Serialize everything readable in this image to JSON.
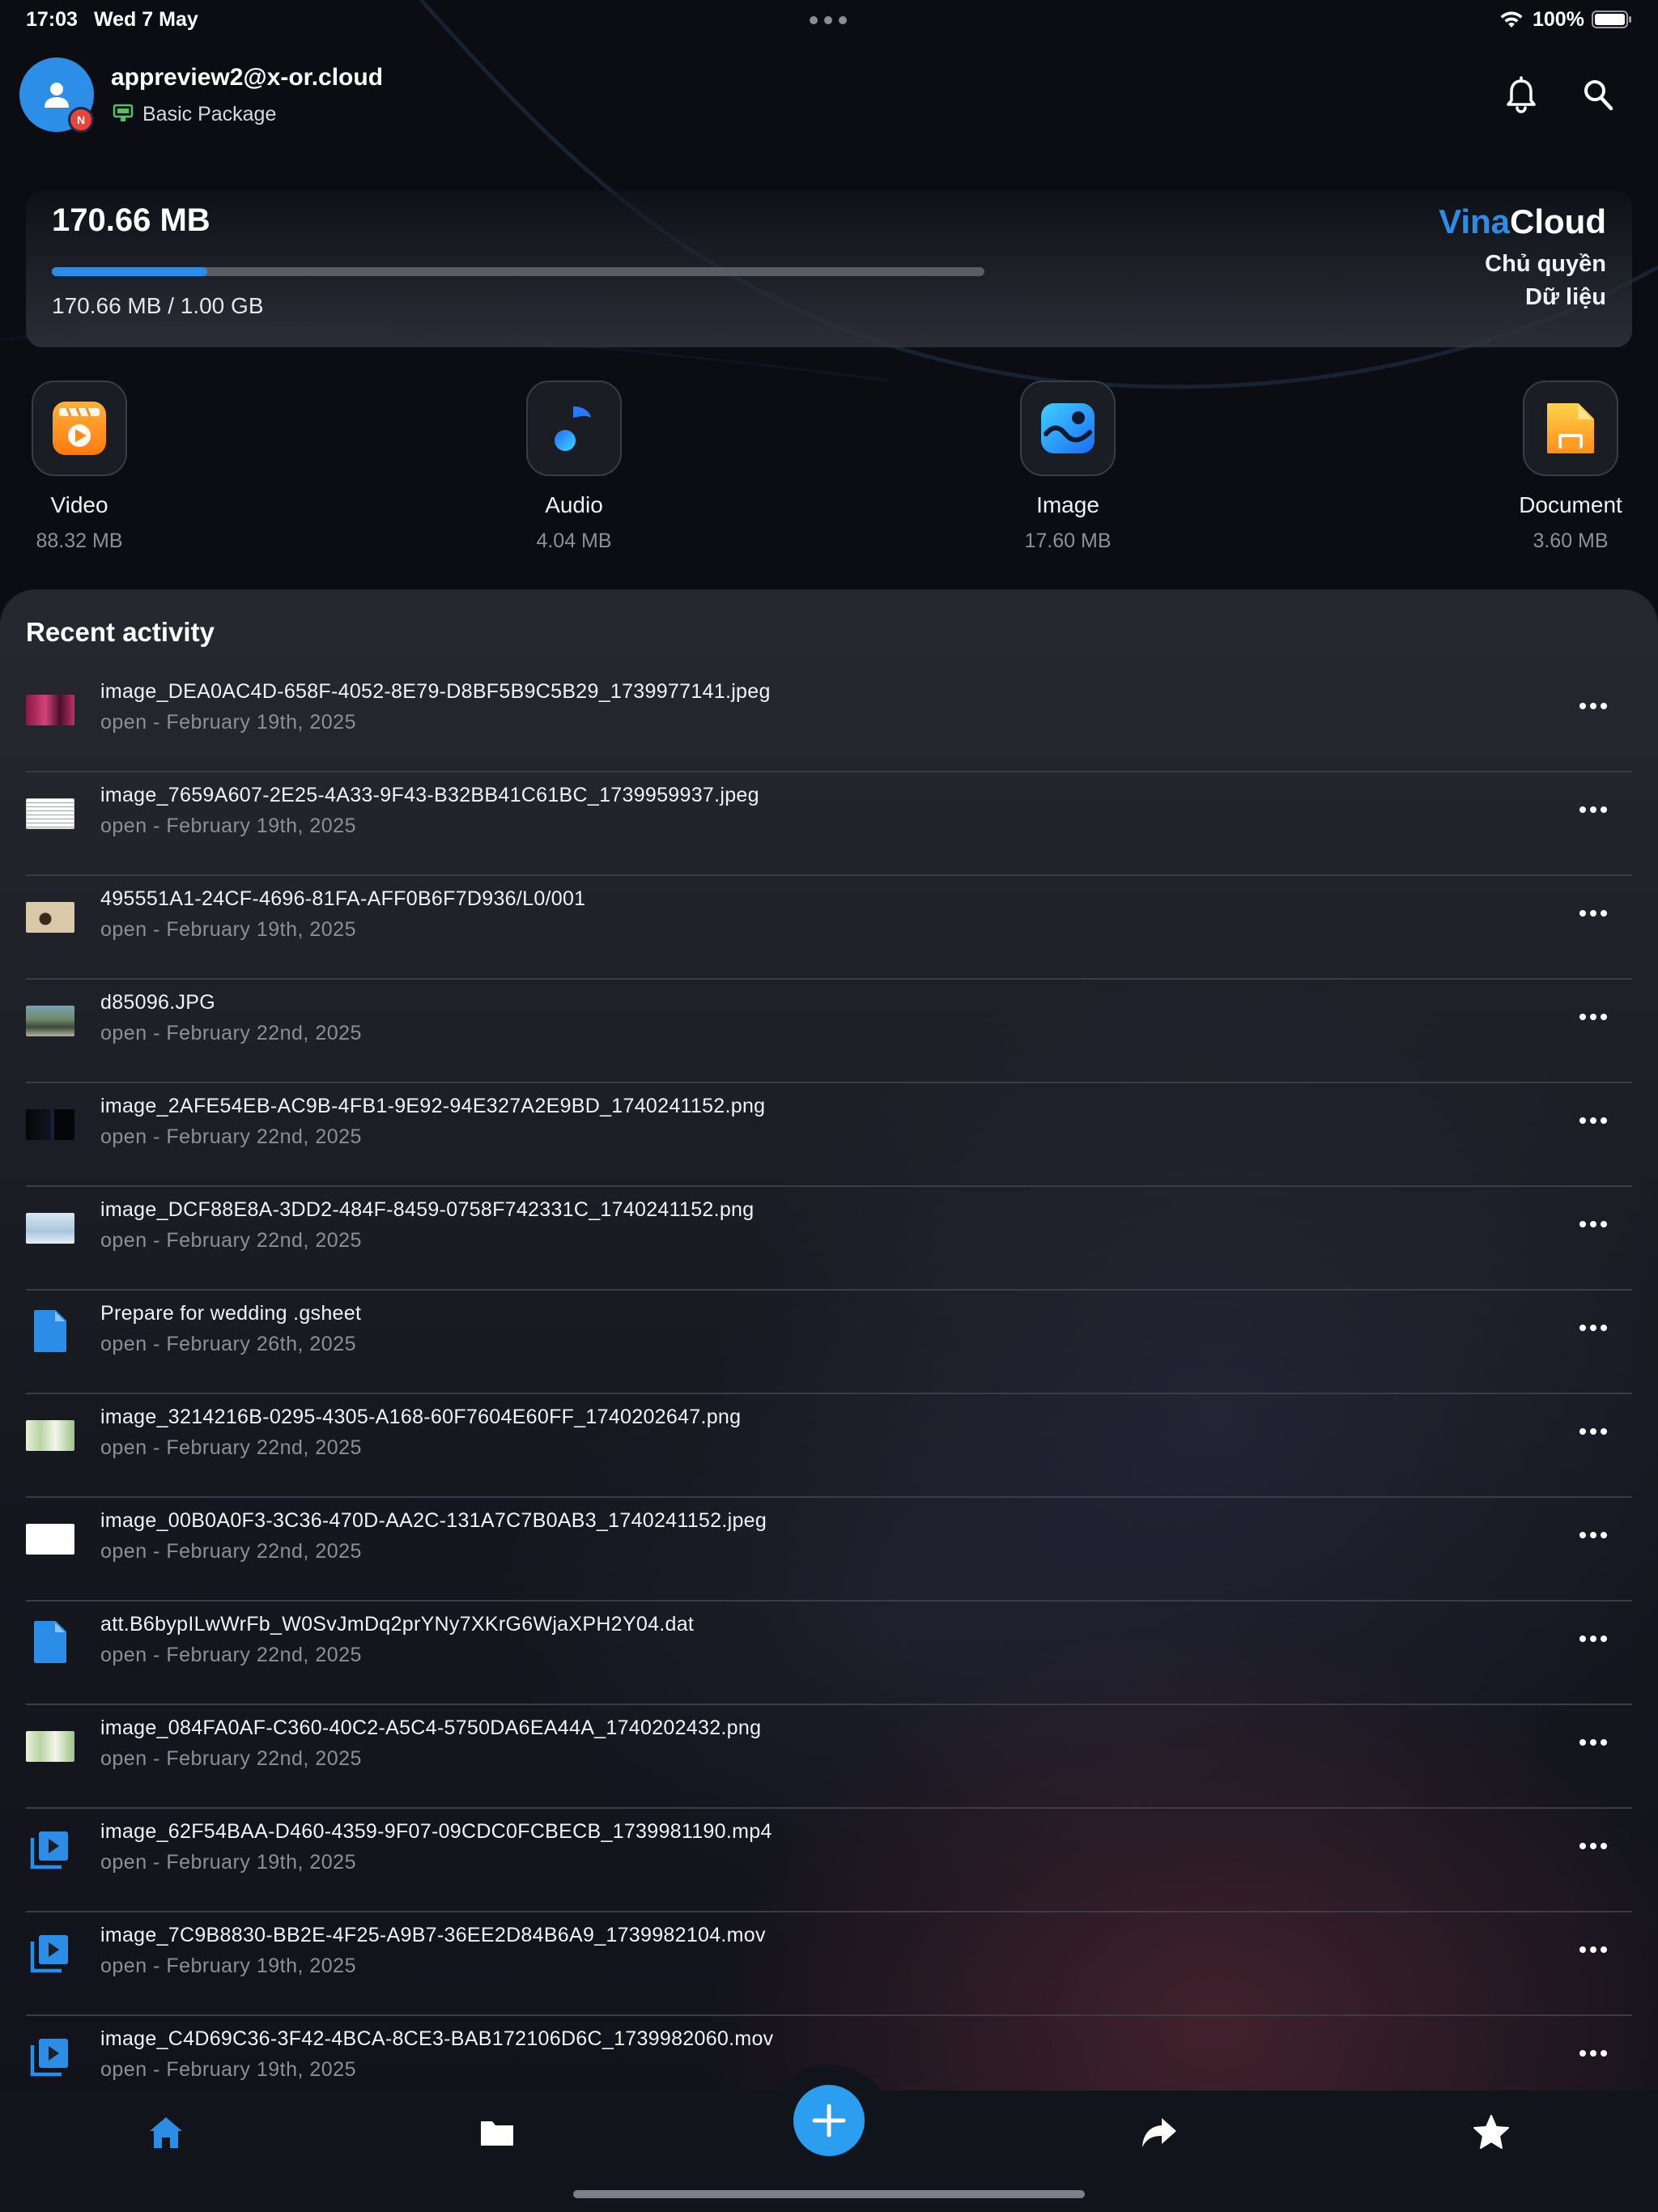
{
  "status_bar": {
    "time": "17:03",
    "date": "Wed 7 May",
    "battery_text": "100%"
  },
  "header": {
    "email": "appreview2@x-or.cloud",
    "package": "Basic Package",
    "avatar_badge": "N"
  },
  "storage": {
    "used": "170.66 MB",
    "ratio_text": "170.66 MB / 1.00 GB",
    "used_fraction": 0.1667,
    "brand_part1": "Vina",
    "brand_part2": "Cloud",
    "tagline_line1": "Chủ quyền",
    "tagline_line2": "Dữ liệu"
  },
  "categories": [
    {
      "name": "Video",
      "size": "88.32 MB",
      "icon": "video-app-icon"
    },
    {
      "name": "Audio",
      "size": "4.04 MB",
      "icon": "music-note-icon"
    },
    {
      "name": "Image",
      "size": "17.60 MB",
      "icon": "image-app-icon"
    },
    {
      "name": "Document",
      "size": "3.60 MB",
      "icon": "document-app-icon"
    }
  ],
  "recent": {
    "title": "Recent activity",
    "items": [
      {
        "name": "image_DEA0AC4D-658F-4052-8E79-D8BF5B9C5B29_1739977141.jpeg",
        "meta": "open - February 19th, 2025",
        "kind": "thumb-pink"
      },
      {
        "name": "image_7659A607-2E25-4A33-9F43-B32BB41C61BC_1739959937.jpeg",
        "meta": "open - February 19th, 2025",
        "kind": "thumb-doc"
      },
      {
        "name": "495551A1-24CF-4696-81FA-AFF0B6F7D936/L0/001",
        "meta": "open - February 19th, 2025",
        "kind": "thumb-tan"
      },
      {
        "name": "d85096.JPG",
        "meta": "open - February 22nd, 2025",
        "kind": "thumb-scene"
      },
      {
        "name": "image_2AFE54EB-AC9B-4FB1-9E92-94E327A2E9BD_1740241152.png",
        "meta": "open - February 22nd, 2025",
        "kind": "thumb-dark"
      },
      {
        "name": "image_DCF88E8A-3DD2-484F-8459-0758F742331C_1740241152.png",
        "meta": "open - February 22nd, 2025",
        "kind": "thumb-sky"
      },
      {
        "name": "Prepare for wedding .gsheet",
        "meta": "open - February 26th, 2025",
        "kind": "file"
      },
      {
        "name": "image_3214216B-0295-4305-A168-60F7604E60FF_1740202647.png",
        "meta": "open - February 22nd, 2025",
        "kind": "thumb-green"
      },
      {
        "name": "image_00B0A0F3-3C36-470D-AA2C-131A7C7B0AB3_1740241152.jpeg",
        "meta": "open - February 22nd, 2025",
        "kind": "thumb-white"
      },
      {
        "name": "att.B6bypILwWrFb_W0SvJmDq2prYNy7XKrG6WjaXPH2Y04.dat",
        "meta": "open - February 22nd, 2025",
        "kind": "file"
      },
      {
        "name": "image_084FA0AF-C360-40C2-A5C4-5750DA6EA44A_1740202432.png",
        "meta": "open - February 22nd, 2025",
        "kind": "thumb-green"
      },
      {
        "name": "image_62F54BAA-D460-4359-9F07-09CDC0FCBECB_1739981190.mp4",
        "meta": "open - February 19th, 2025",
        "kind": "video"
      },
      {
        "name": "image_7C9B8830-BB2E-4F25-A9B7-36EE2D84B6A9_1739982104.mov",
        "meta": "open - February 19th, 2025",
        "kind": "video"
      },
      {
        "name": "image_C4D69C36-3F42-4BCA-8CE3-BAB172106D6C_1739982060.mov",
        "meta": "open - February 19th, 2025",
        "kind": "video"
      }
    ]
  },
  "bottom_nav": {
    "items": [
      "home-icon",
      "folder-icon",
      "share-icon",
      "star-icon"
    ],
    "fab": "plus-icon"
  },
  "colors": {
    "accent": "#2b8de6",
    "fab": "#2b9ef0",
    "background": "#0b0d13"
  }
}
